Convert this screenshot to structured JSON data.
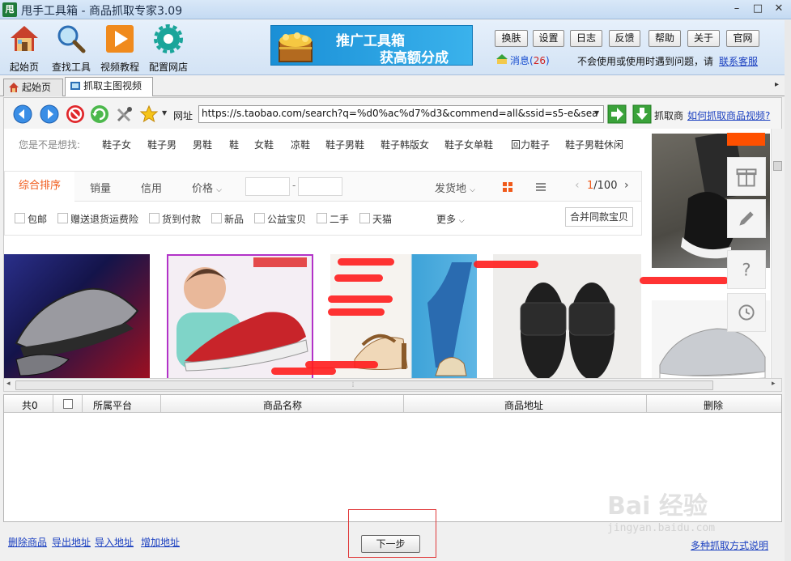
{
  "window": {
    "app_icon": "甩",
    "title": "甩手工具箱 - 商品抓取专家3.09",
    "minimize": "–",
    "maximize": "□",
    "close": "✕"
  },
  "toolbar": {
    "home": "起始页",
    "find_tool": "查找工具",
    "video_tutorial": "视频教程",
    "config_shop": "配置网店",
    "banner_line1": "推广工具箱",
    "banner_line2": "获高额分成",
    "buttons": {
      "skin": "换肤",
      "settings": "设置",
      "log": "日志",
      "feedback": "反馈",
      "help": "帮助",
      "about": "关于",
      "website": "官网"
    },
    "message_label": "消息(",
    "message_count": "26",
    "message_close": ")",
    "notice": "不会使用或使用时遇到问题，请",
    "notice_link": "联系客服"
  },
  "tabs": {
    "home": "起始页",
    "grab": "抓取主图视频"
  },
  "navbar": {
    "address_label": "网址",
    "address_value": "https://s.taobao.com/search?q=%d0%ac%d7%d3&commend=all&ssid=s5-e&sea",
    "grab_label": "抓取商",
    "grab_link": "如何抓取商品视频?"
  },
  "page": {
    "suggest_label": "您是不是想找:",
    "suggestions": [
      "鞋子女",
      "鞋子男",
      "男鞋",
      "鞋",
      "女鞋",
      "凉鞋",
      "鞋子男鞋",
      "鞋子韩版女",
      "鞋子女单鞋",
      "回力鞋子",
      "鞋子男鞋休闲"
    ],
    "sort": {
      "active": "综合排序",
      "sales": "销量",
      "credit": "信用",
      "price": "价格",
      "price_dash": "-",
      "ship_from": "发货地",
      "page_current": "1",
      "page_total": "/100"
    },
    "filters": [
      "包邮",
      "赠送退货运费险",
      "货到付款",
      "新品",
      "公益宝贝",
      "二手",
      "天猫"
    ],
    "more": "更多",
    "merge": "合并同款宝贝"
  },
  "grid": {
    "count": "共0",
    "platform": "所属平台",
    "product_name": "商品名称",
    "product_url": "商品地址",
    "delete": "删除"
  },
  "bottom": {
    "delete_products": "删除商品",
    "export_urls": "导出地址",
    "import_urls": "导入地址",
    "add_url": "增加地址",
    "next": "下一步",
    "methods": "多种抓取方式说明"
  },
  "watermark": {
    "brand": "Bai 经验",
    "url": "jingyan.baidu.com"
  },
  "icons": [
    "home-icon",
    "search-icon",
    "play-icon",
    "gear-icon",
    "back-icon",
    "forward-icon",
    "stop-icon",
    "refresh-icon",
    "tools-icon",
    "star-icon",
    "go-icon",
    "download-icon",
    "gift-icon",
    "pencil-icon",
    "question-icon",
    "clock-icon",
    "grid-view-icon",
    "list-view-icon"
  ],
  "colors": {
    "accent_orange": "#f05a1a",
    "link_blue": "#1a3fc0",
    "highlight_red": "#e0393a"
  }
}
